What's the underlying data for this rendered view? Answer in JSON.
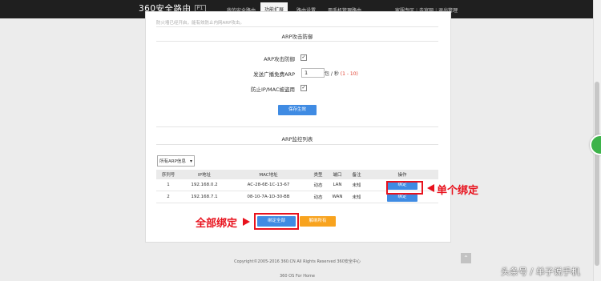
{
  "header": {
    "logo_text": "360安全路由",
    "version_badge": "P1",
    "tabs": [
      "我的安全路由",
      "功能扩展",
      "路由设置",
      "用手机管理路由"
    ],
    "active_tab_index": 1,
    "links": [
      "家服专区",
      "去官网",
      "退出管理"
    ]
  },
  "panel": {
    "faded_text": "防火墙已经开启，能有效防止内网ARP攻击。",
    "arp_defense": {
      "title": "ARP攻击防御",
      "defense_label": "ARP攻击防御",
      "defense_checked": "✓",
      "broadcast_label": "发送广播免费ARP",
      "broadcast_value": "1",
      "broadcast_unit": "包 / 秒",
      "broadcast_range": "(1 - 10)",
      "anti_spoof_label": "防止IP/MAC被盗用",
      "anti_spoof_checked": "✓",
      "save_button": "保存生效"
    },
    "arp_monitor": {
      "title": "ARP监控列表",
      "filter_selected": "所有ARP信息",
      "columns": [
        "序列号",
        "IP地址",
        "MAC地址",
        "类型",
        "端口",
        "备注",
        "操作"
      ],
      "rows": [
        {
          "index": "1",
          "ip": "192.168.0.2",
          "mac": "AC-28-6E-1C-13-67",
          "type": "动态",
          "port": "LAN",
          "note": "未知",
          "action": "绑定"
        },
        {
          "index": "2",
          "ip": "192.168.7.1",
          "mac": "08-10-7A-1D-30-BB",
          "type": "动态",
          "port": "WAN",
          "note": "未知",
          "action": "绑定"
        }
      ],
      "bind_all_button": "绑定全部",
      "unbind_all_button": "解绑所有"
    }
  },
  "annotations": {
    "single_bind": "单个绑定",
    "bind_all": "全部绑定",
    "color": "#e8121d"
  },
  "footer": {
    "copyright": "Copyright©2005-2016 360.CN All Rights Reserved 360安全中心",
    "os": "360 OS For Home"
  },
  "watermark": "头条号 / 单子说手机"
}
